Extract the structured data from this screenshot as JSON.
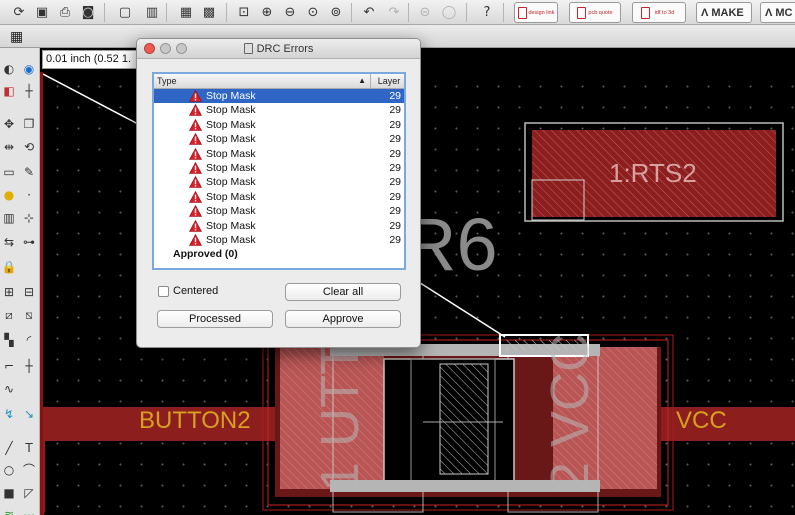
{
  "toolbar": {
    "icons": [
      "open-icon",
      "save-icon",
      "print-icon",
      "cam-icon",
      "script-icon",
      "run-icon",
      "board-icon",
      "zoom-fit-icon",
      "zoom-in-icon",
      "zoom-out-icon",
      "zoom-select-icon",
      "zoom-redraw-icon",
      "undo-icon",
      "redo-icon",
      "stop-icon",
      "go-icon",
      "help-icon"
    ],
    "design_link": "design link",
    "pcb_quote": "PCB quote",
    "idf_to_3d": "IDF to 3D",
    "make_label": "MAKE",
    "mc_label": "MC"
  },
  "coordinate": "0.01 inch (0.52 1.",
  "canvas": {
    "big_label": "R6",
    "pad_label": "1:RTS2",
    "net_left": "BUTTON2",
    "net_right": "VCC",
    "colors": {
      "layer_red": "#8c1e1e",
      "net_text": "#d8a021"
    }
  },
  "drc": {
    "title": "DRC Errors",
    "columns": {
      "type": "Type",
      "layer": "Layer"
    },
    "errors": [
      {
        "type": "Stop Mask",
        "layer": "29"
      },
      {
        "type": "Stop Mask",
        "layer": "29"
      },
      {
        "type": "Stop Mask",
        "layer": "29"
      },
      {
        "type": "Stop Mask",
        "layer": "29"
      },
      {
        "type": "Stop Mask",
        "layer": "29"
      },
      {
        "type": "Stop Mask",
        "layer": "29"
      },
      {
        "type": "Stop Mask",
        "layer": "29"
      },
      {
        "type": "Stop Mask",
        "layer": "29"
      },
      {
        "type": "Stop Mask",
        "layer": "29"
      },
      {
        "type": "Stop Mask",
        "layer": "29"
      },
      {
        "type": "Stop Mask",
        "layer": "29"
      }
    ],
    "approved": "Approved (0)",
    "centered_label": "Centered",
    "centered_checked": false,
    "clear_all": "Clear all",
    "processed": "Processed",
    "approve": "Approve"
  }
}
